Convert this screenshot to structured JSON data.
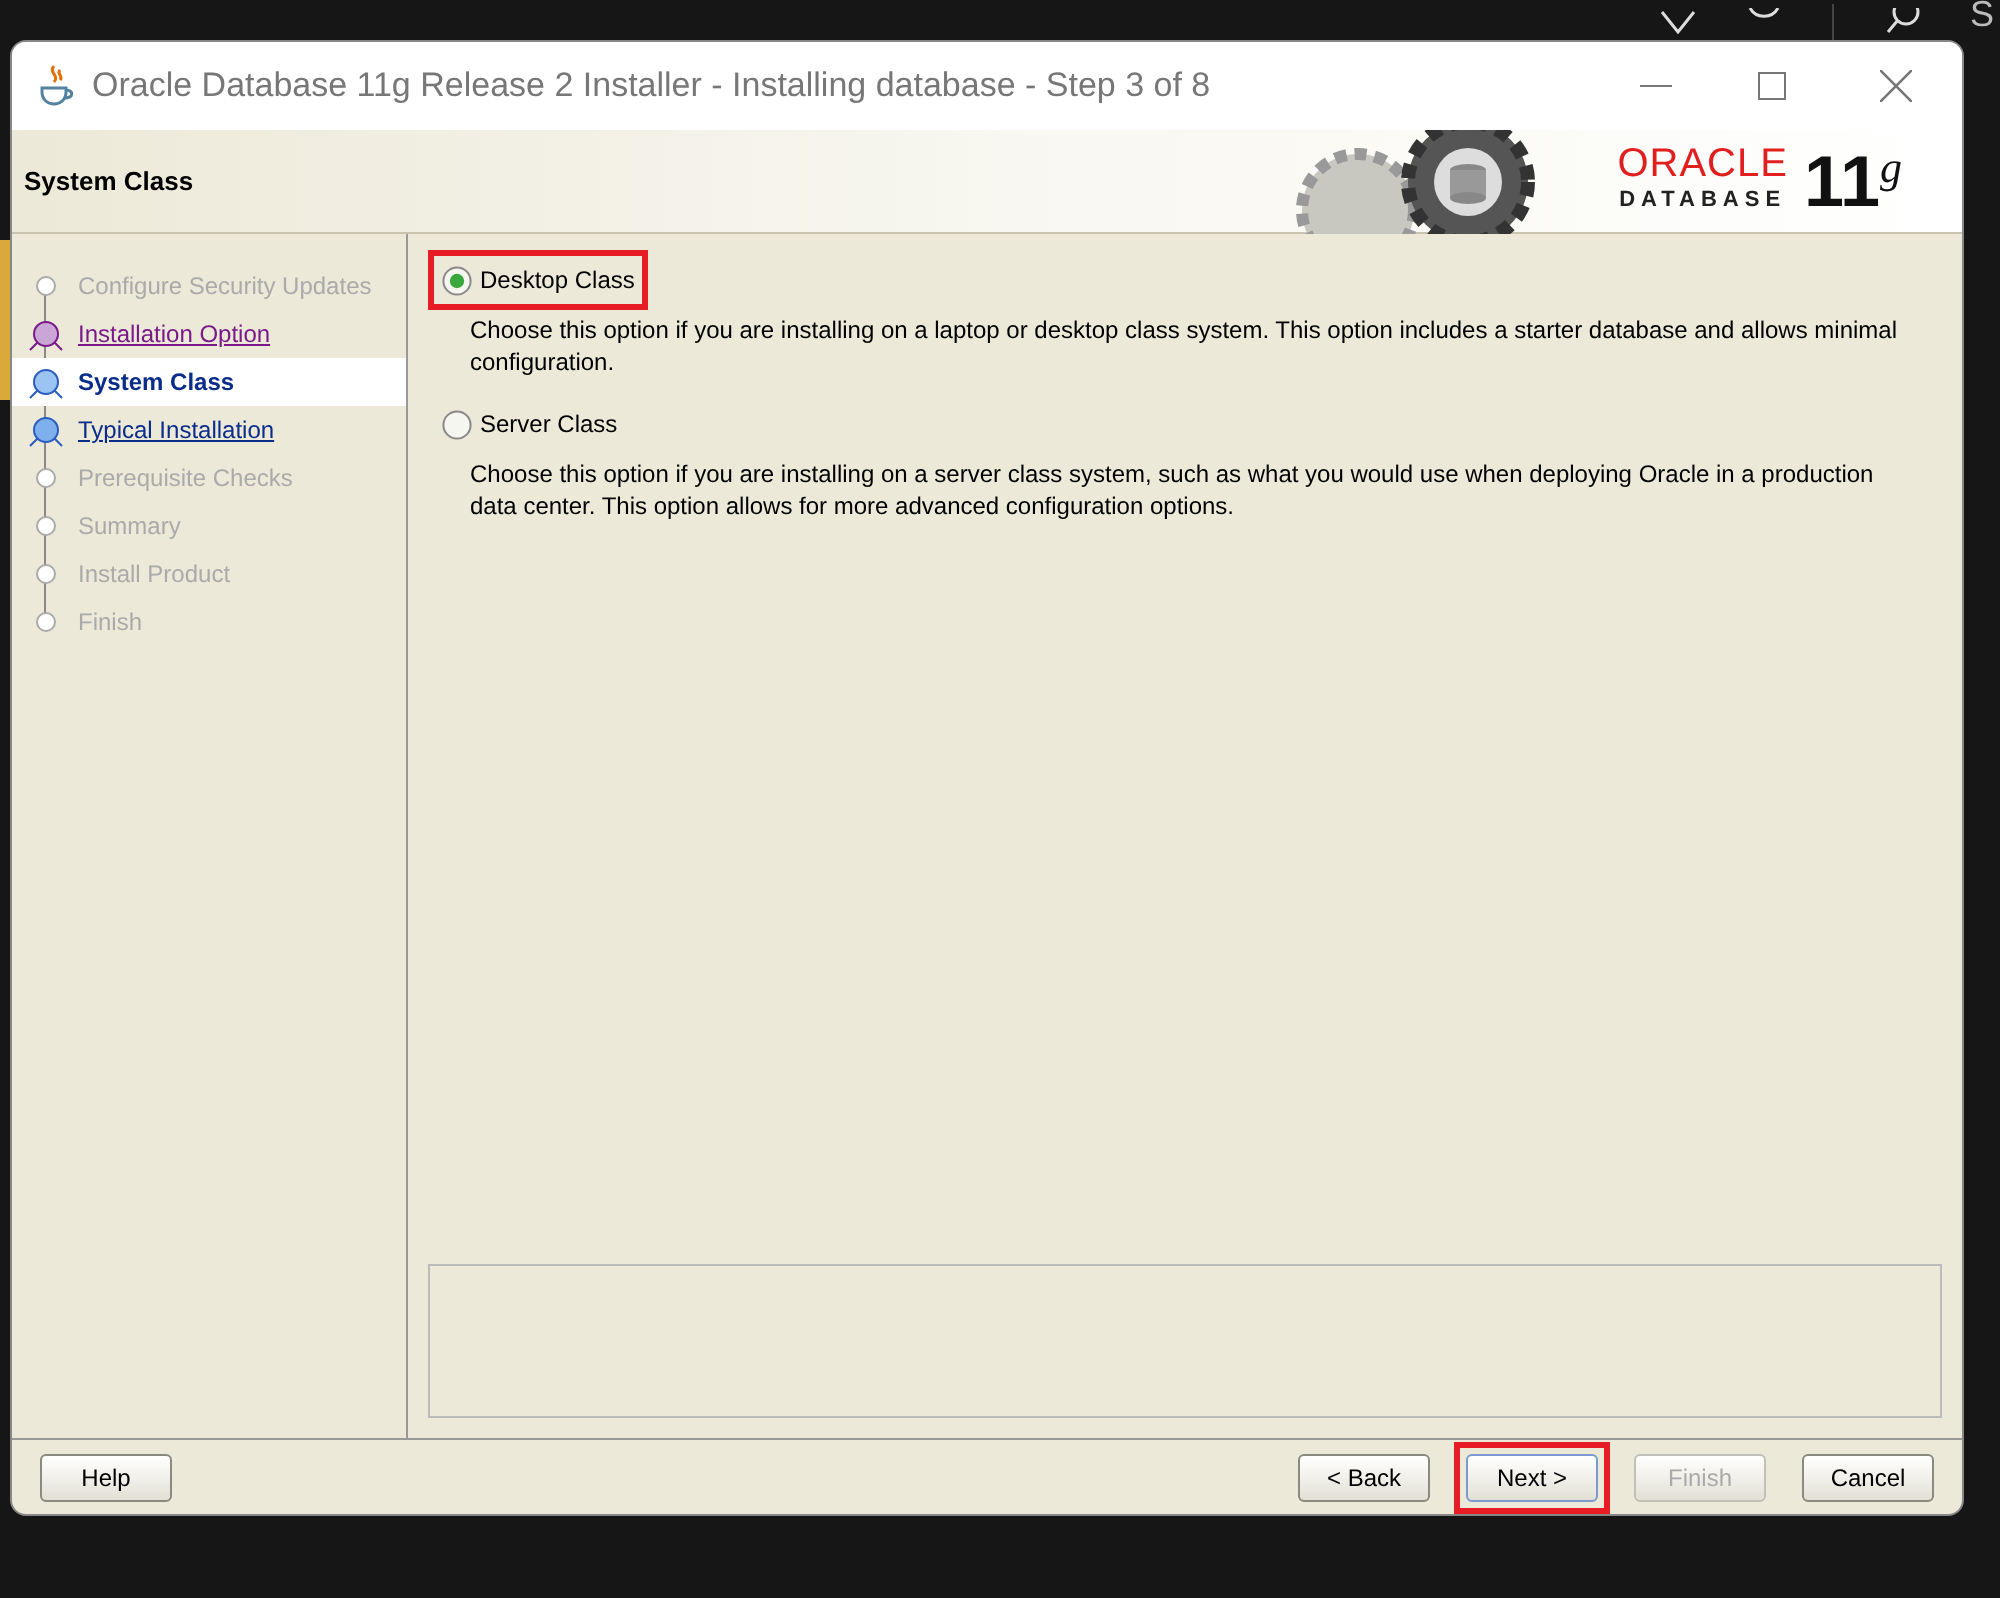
{
  "backdrop": {
    "text": "S"
  },
  "window": {
    "title": "Oracle Database 11g Release 2 Installer - Installing database - Step 3 of 8"
  },
  "header": {
    "title": "System Class",
    "logo_brand": "ORACLE",
    "logo_product": "DATABASE",
    "logo_version": "11",
    "logo_suffix": "g"
  },
  "steps": [
    {
      "label": "Configure Security Updates",
      "kind": "done"
    },
    {
      "label": "Installation Option",
      "kind": "visited"
    },
    {
      "label": "System Class",
      "kind": "current"
    },
    {
      "label": "Typical Installation",
      "kind": "link"
    },
    {
      "label": "Prerequisite Checks",
      "kind": "pending"
    },
    {
      "label": "Summary",
      "kind": "pending"
    },
    {
      "label": "Install Product",
      "kind": "pending"
    },
    {
      "label": "Finish",
      "kind": "pending"
    }
  ],
  "options": [
    {
      "label": "Desktop Class",
      "selected": true,
      "highlighted": true,
      "description": "Choose this option if you are installing on a laptop or desktop class system. This option includes a starter database and allows minimal configuration."
    },
    {
      "label": "Server Class",
      "selected": false,
      "highlighted": false,
      "description": "Choose this option if you are installing on a server class system, such as what you would use when deploying Oracle in a production data center. This option allows for more advanced configuration options."
    }
  ],
  "buttons": [
    {
      "label": "Help",
      "disabled": false,
      "highlighted": false,
      "focused": false
    },
    {
      "label": "< Back",
      "disabled": false,
      "highlighted": false,
      "focused": false
    },
    {
      "label": "Next >",
      "disabled": false,
      "highlighted": true,
      "focused": true
    },
    {
      "label": "Finish",
      "disabled": true,
      "highlighted": false,
      "focused": false
    },
    {
      "label": "Cancel",
      "disabled": false,
      "highlighted": false,
      "focused": false
    }
  ]
}
